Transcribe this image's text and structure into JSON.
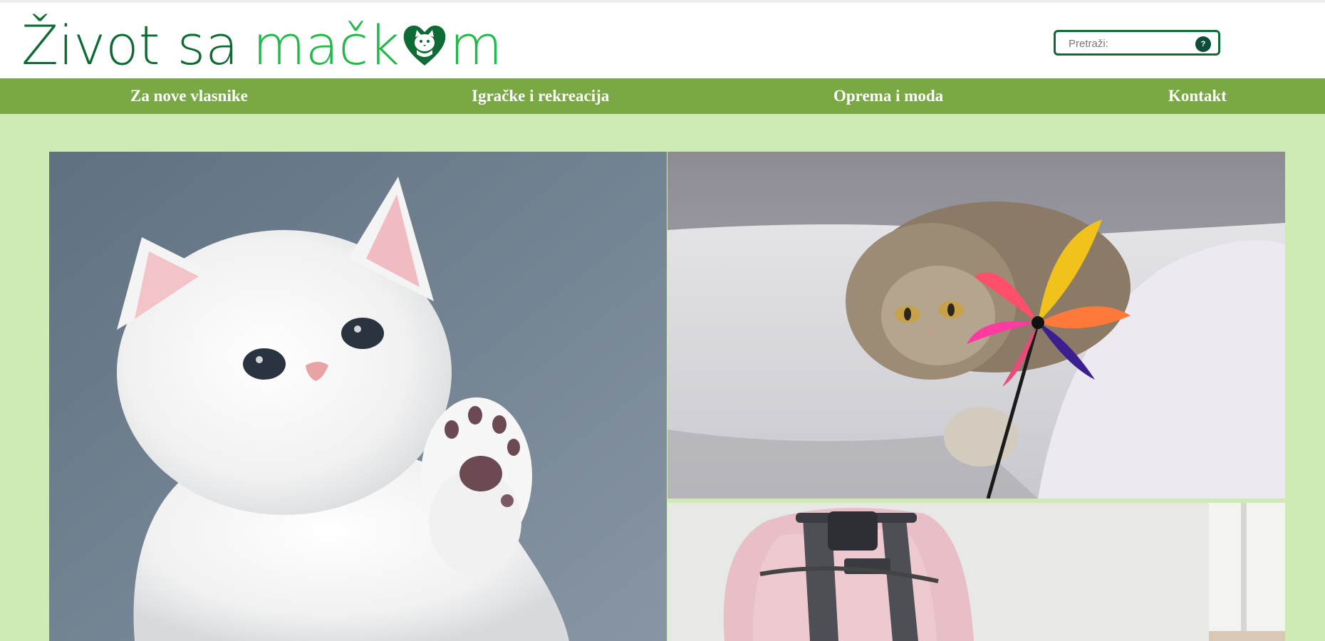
{
  "site": {
    "logo": {
      "part1": "Život sa",
      "part2_before": "mačk",
      "part2_after": "m"
    },
    "search": {
      "placeholder": "Pretraži:",
      "help_label": "?"
    }
  },
  "nav": {
    "items": [
      {
        "label": "Za nove vlasnike"
      },
      {
        "label": "Igračke i rekreacija"
      },
      {
        "label": "Oprema i moda"
      },
      {
        "label": "Kontakt"
      }
    ]
  },
  "colors": {
    "page_background": "#d0eab5",
    "nav_background": "#7aa845",
    "logo_dark_green": "#0e6b34",
    "logo_light_green": "#22b84a"
  },
  "icons": {
    "logo_heart": "heart-cat-icon",
    "search_help": "question-icon"
  },
  "images": [
    {
      "name": "white-kitten-photo"
    },
    {
      "name": "cat-with-feather-toy-photo"
    },
    {
      "name": "pink-pet-carrier-photo"
    }
  ]
}
